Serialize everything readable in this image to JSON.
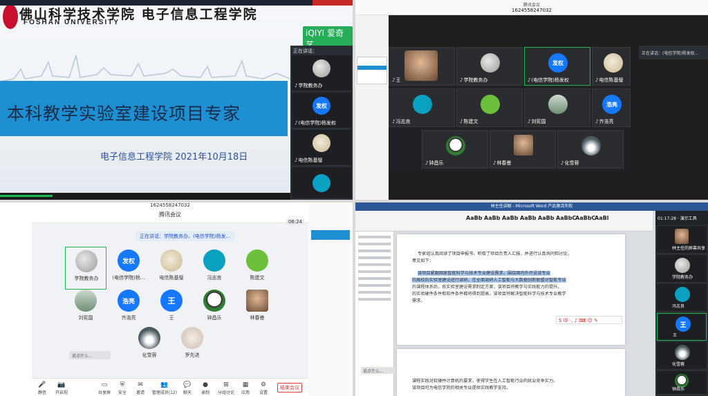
{
  "q1": {
    "university_cn": "佛山科学技术学院 电子信息工程学院",
    "university_en": "FOSHAN UNIVERSITY",
    "watermark": "iQIYI 爱奇艺",
    "slide_title": "本科教学实验室建设项目专家",
    "slide_subtitle": "电子信息工程学院   2021年10月18日",
    "side_header": "正在讲话：",
    "side_tiles": [
      {
        "name": "学院教务办"
      },
      {
        "name": "(电信学院)杨发权",
        "avatar_text": "发权"
      },
      {
        "name": "电信陈基璧"
      },
      {
        "name": ""
      }
    ]
  },
  "q2": {
    "app": "腾讯会议",
    "meeting_id": "1624558247032",
    "speaking": "正在讲话：(电信学院)杨发权...",
    "tiles": [
      {
        "name": "王"
      },
      {
        "name": "学院教务办"
      },
      {
        "name": "(电信学院)杨发权",
        "avatar_text": "发权"
      },
      {
        "name": "电信陈基璧"
      },
      {
        "name": "冯志良"
      },
      {
        "name": "陈建文"
      },
      {
        "name": "刘宪国"
      },
      {
        "name": "齐浩亮",
        "avatar_text": "浩亮"
      },
      {
        "name": "钟昌乐"
      },
      {
        "name": "林春曼"
      },
      {
        "name": "化雪蓉"
      }
    ]
  },
  "q3": {
    "meeting_id": "1624558247032",
    "app": "腾讯会议",
    "timer": "06:24",
    "speaking": "正在讲话：学院教务办，(电信学院)杨发...",
    "participants": [
      {
        "name": "学院教务办"
      },
      {
        "name": "(电信学院)杨...",
        "avatar_text": "发权"
      },
      {
        "name": "电信陈基璧"
      },
      {
        "name": "冯志良"
      },
      {
        "name": "陈建文"
      },
      {
        "name": "刘宪国"
      },
      {
        "name": "齐浩亮",
        "avatar_text": "浩亮"
      },
      {
        "name": "王",
        "avatar_text": "王"
      },
      {
        "name": "钟昌乐"
      },
      {
        "name": "林春曼"
      },
      {
        "name": "化雪蓉"
      },
      {
        "name": "罗先进"
      }
    ],
    "chat_placeholder": "说点什么...",
    "toolbar": [
      {
        "label": "静音",
        "icon": "mic-icon",
        "glyph": "🎤"
      },
      {
        "label": "开启视频",
        "icon": "camera-icon",
        "glyph": "📷"
      },
      {
        "label": "共享屏幕",
        "icon": "share-icon",
        "glyph": "▭"
      },
      {
        "label": "安全",
        "icon": "shield-icon",
        "glyph": "⛨"
      },
      {
        "label": "邀请",
        "icon": "invite-icon",
        "glyph": "✉"
      },
      {
        "label": "管理成员(12)",
        "icon": "members-icon",
        "glyph": "👥"
      },
      {
        "label": "聊天",
        "icon": "chat-icon",
        "glyph": "💬"
      },
      {
        "label": "录制",
        "icon": "record-icon",
        "glyph": "●"
      },
      {
        "label": "分组讨论",
        "icon": "group-icon",
        "glyph": "⊞"
      },
      {
        "label": "应用",
        "icon": "apps-icon",
        "glyph": "▦"
      },
      {
        "label": "设置",
        "icon": "gear-icon",
        "glyph": "⚙"
      }
    ],
    "end_button": "结束会议"
  },
  "q4": {
    "window_title": "林主任讲解 - Microsoft Word 产品激活失败",
    "timer": "01:17:28",
    "share_label": "演示工具",
    "ribbon_styles": [
      "AaBb",
      "AaBb",
      "AaBb",
      "AaBb",
      "AaBb",
      "AaBbC",
      "AaBbC",
      "AaBl"
    ],
    "paragraph": [
      "专家组认真阅读了项目申报书，听取了项目负责人汇报，并进行认真询问和讨论，",
      "意见如下：",
      "该项目紧跟国家智能科学与技术专业建设需求，围绕国内外开设该专业",
      "的高校的实验室建设进行调研，在全面调研人工智能与大数据创新联盟对智能专业",
      "的课程体系后，依实验室建设需求制定方案，该项目将教学与实践能力的提升。",
      "的实验硬件条件和软件条件都将得到提高。该项目将解决智能科学与技术专业教学",
      "需求。"
    ],
    "page2": [
      "课程实践对软硬件计算机的要求，使得学生在人工智能行业的就业竞争实力。",
      "该项目可为电信学院的相关专业提供实践教学支持。"
    ],
    "ime_text": "S 中 ·, ♪ ⌨ ☺ ✎",
    "chat_placeholder": "说点什么...",
    "side_top": "林主任的屏幕共享",
    "side_tiles": [
      {
        "name": "林主任的屏幕共享"
      },
      {
        "name": "学院教务办"
      },
      {
        "name": "冯志良"
      },
      {
        "name": "王",
        "avatar_text": "王"
      },
      {
        "name": "化雪蓉"
      },
      {
        "name": "钟昌乐"
      }
    ]
  }
}
